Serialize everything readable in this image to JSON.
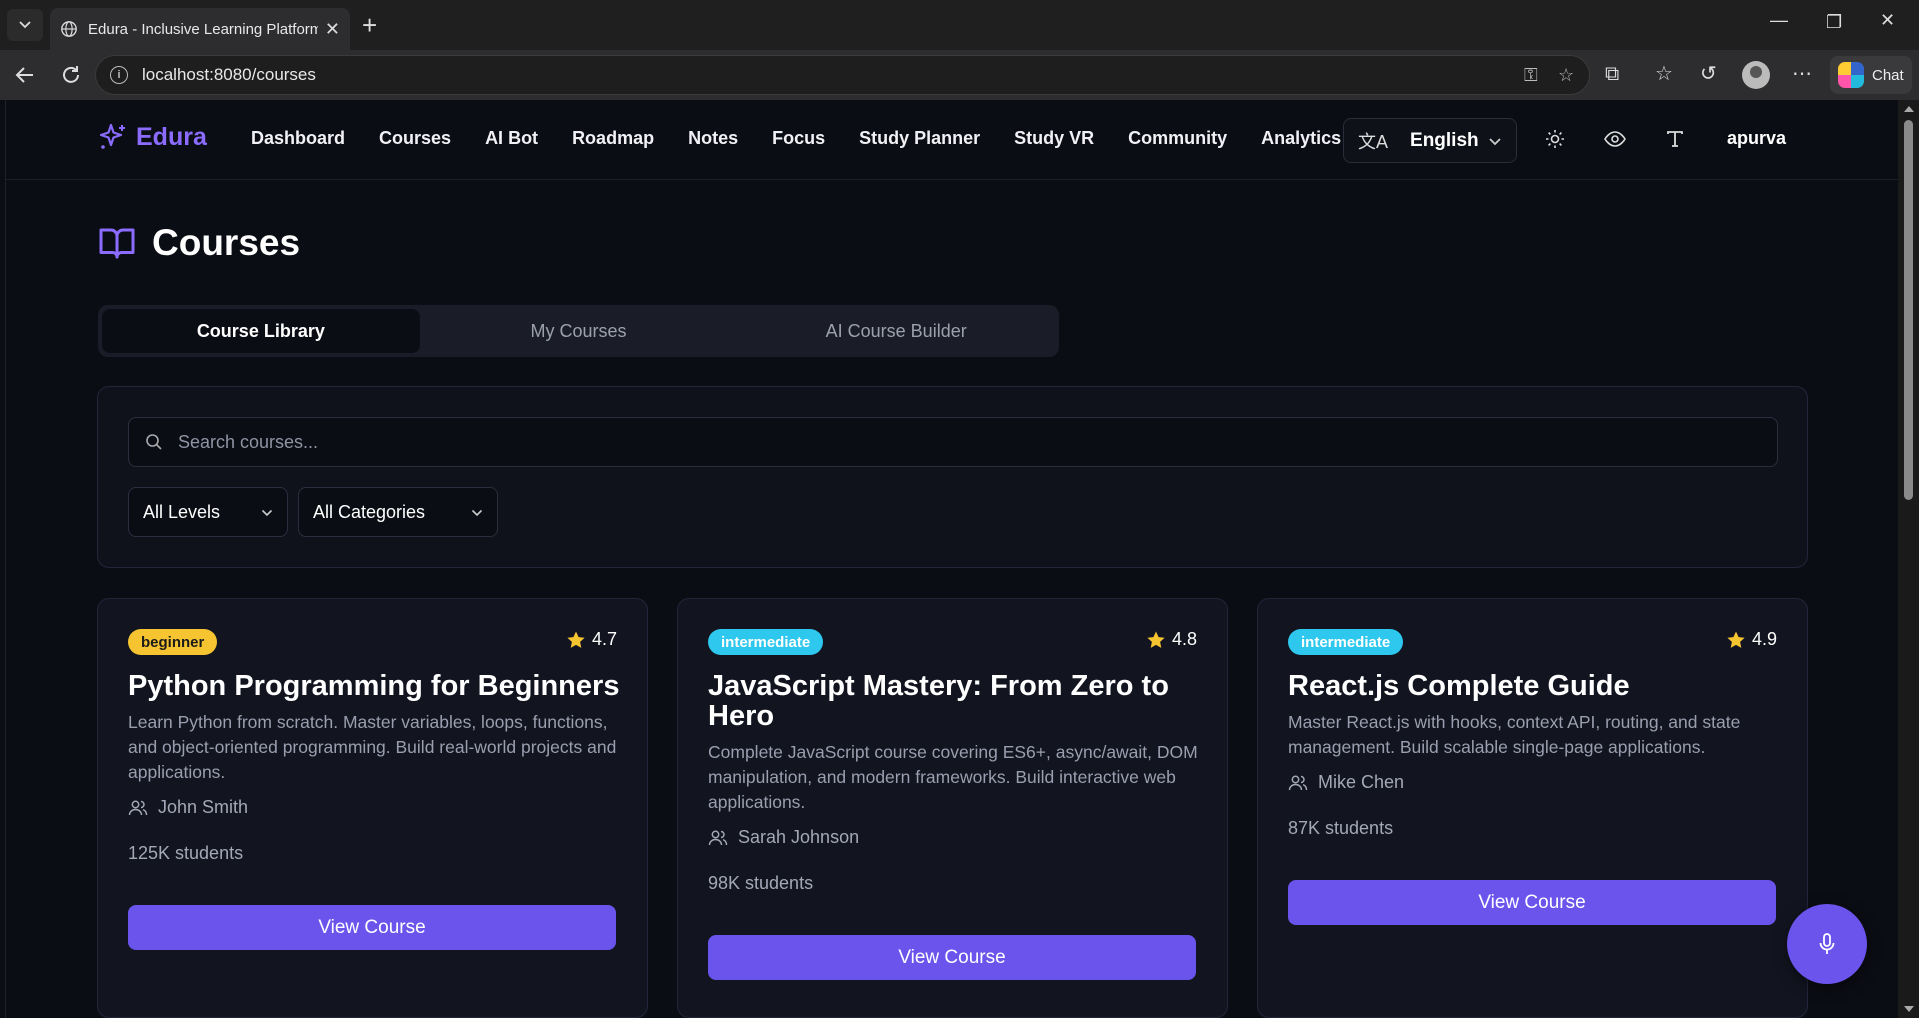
{
  "browser": {
    "tab_title": "Edura - Inclusive Learning Platform",
    "url": "localhost:8080/courses",
    "chat_label": "Chat"
  },
  "app": {
    "logo": "Edura",
    "nav": [
      "Dashboard",
      "Courses",
      "AI Bot",
      "Roadmap",
      "Notes",
      "Focus",
      "Study Planner",
      "Study VR",
      "Community",
      "Analytics"
    ],
    "language": "English",
    "username": "apurva"
  },
  "page": {
    "title": "Courses",
    "tabs": [
      {
        "label": "Course Library",
        "active": true
      },
      {
        "label": "My Courses",
        "active": false
      },
      {
        "label": "AI Course Builder",
        "active": false
      }
    ],
    "search_placeholder": "Search courses...",
    "level_filter": "All Levels",
    "category_filter": "All Categories"
  },
  "courses": [
    {
      "level": "beginner",
      "rating": "4.7",
      "title": "Python Programming for Beginners",
      "description": "Learn Python from scratch. Master variables, loops, functions, and object-oriented programming. Build real-world projects and applications.",
      "instructor": "John Smith",
      "students": "125K students",
      "button": "View Course"
    },
    {
      "level": "intermediate",
      "rating": "4.8",
      "title": "JavaScript Mastery: From Zero to Hero",
      "description": "Complete JavaScript course covering ES6+, async/await, DOM manipulation, and modern frameworks. Build interactive web applications.",
      "instructor": "Sarah Johnson",
      "students": "98K students",
      "button": "View Course"
    },
    {
      "level": "intermediate",
      "rating": "4.9",
      "title": "React.js Complete Guide",
      "description": "Master React.js with hooks, context API, routing, and state management. Build scalable single-page applications.",
      "instructor": "Mike Chen",
      "students": "87K students",
      "button": "View Course"
    }
  ],
  "colors": {
    "accent": "#6b54ec",
    "logo": "#8b6cff",
    "beginner_badge": "#f6c431",
    "intermediate_badge": "#2ec8ee",
    "star": "#f6c431",
    "background": "#0b0d14"
  },
  "icons": [
    "chevron-down-icon",
    "globe-icon",
    "close-icon",
    "plus-icon",
    "back-icon",
    "reload-icon",
    "info-icon",
    "key-icon",
    "star-outline-icon",
    "extensions-icon",
    "favorites-icon",
    "history-icon",
    "profile-icon",
    "more-icon",
    "copilot-icon",
    "sparkles-icon",
    "translate-icon",
    "sun-icon",
    "eye-icon",
    "type-icon",
    "book-open-icon",
    "search-icon",
    "star-icon",
    "users-icon",
    "mic-icon"
  ]
}
